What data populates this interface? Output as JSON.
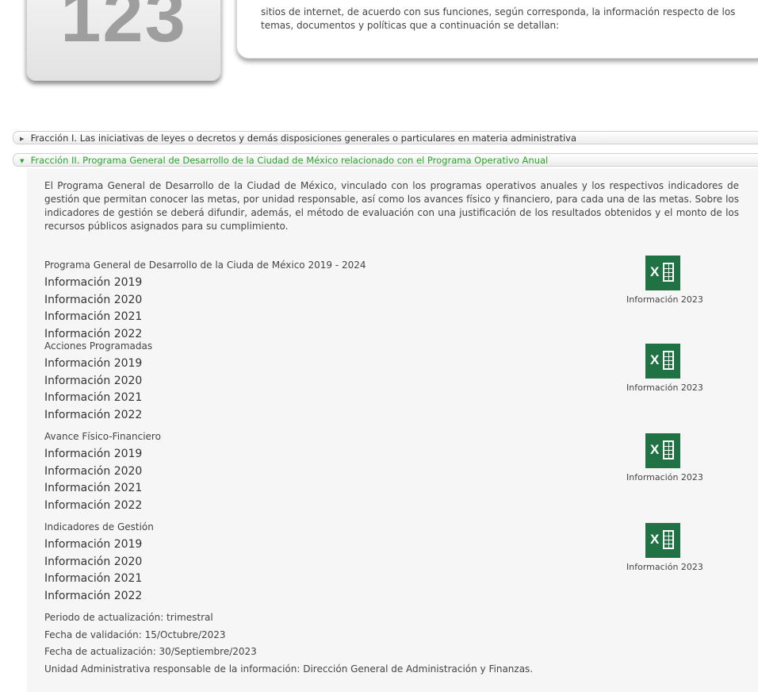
{
  "header": {
    "badge_number": "123",
    "intro_text": "sitios de internet, de acuerdo con sus funciones, según corresponda, la información respecto de los temas, documentos y políticas que a continuación se detallan:"
  },
  "fractions": [
    {
      "label": "Fracción I. Las iniciativas de leyes o decretos y demás disposiciones generales o particulares en materia administrativa",
      "expanded": false
    },
    {
      "label": "Fracción II. Programa General de Desarrollo de la Ciudad de México relacionado con el Programa Operativo Anual",
      "expanded": true
    }
  ],
  "panel": {
    "description": "El Programa General de Desarrollo de la Ciudad de México, vinculado con los programas operativos anuales y los respectivos indicadores de gestión que permitan conocer las metas, por unidad responsable, así como los avances físico y financiero, para cada una de las metas. Sobre los indicadores de gestión se deberá difundir, además, el método de evaluación con una justificación de los resultados obtenidos y el monto de los recursos públicos asignados para su cumplimiento.",
    "sections": [
      {
        "title": "Programa General de Desarrollo de la Ciuda de México 2019 - 2024",
        "links": [
          "Información 2019",
          "Información 2020",
          "Información 2021",
          "Información 2022"
        ],
        "excel_label": "Información 2023"
      },
      {
        "title": "Acciones Programadas",
        "links": [
          "Información 2019",
          "Información 2020",
          "Información 2021",
          "Información 2022"
        ],
        "excel_label": "Información 2023"
      },
      {
        "title": "Avance Físico-Financiero",
        "links": [
          "Información 2019",
          "Información 2020",
          "Información 2021",
          "Información 2022"
        ],
        "excel_label": "Información 2023"
      },
      {
        "title": "Indicadores de Gestión",
        "links": [
          "Información 2019",
          "Información 2020",
          "Información 2021",
          "Información 2022"
        ],
        "excel_label": "Información 2023"
      }
    ],
    "footer": [
      "Periodo de actualización: trimestral",
      "Fecha de validación: 15/Octubre/2023",
      "Fecha de actualización: 30/Septiembre/2023",
      "Unidad Administrativa responsable de la información: Dirección General de Administración y Finanzas."
    ]
  },
  "colors": {
    "active_fraction": "#2aa52a",
    "excel_green": "#207245"
  },
  "icons": {
    "collapsed": "triangle-right-icon",
    "expanded": "triangle-down-icon",
    "file": "excel-icon"
  }
}
